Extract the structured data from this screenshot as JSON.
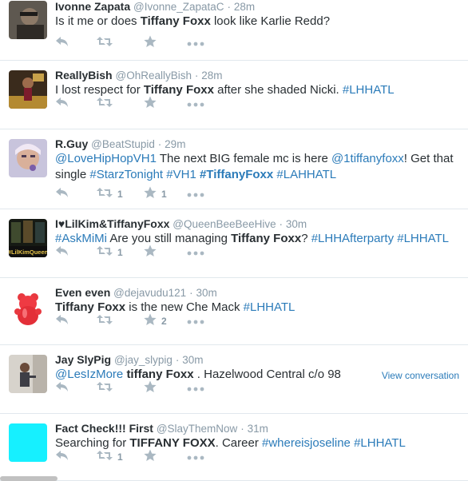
{
  "colors": {
    "link": "#2b7bb9",
    "muted": "#8899a6",
    "icon": "#aab8c2",
    "divider": "#e1e8ed"
  },
  "icons": [
    "reply-icon",
    "retweet-icon",
    "favorite-icon",
    "more-icon"
  ],
  "tweets": [
    {
      "fullname": "Ivonne Zapata",
      "username": "@Ivonne_ZapataC",
      "sep": "·",
      "time": "28m",
      "avatar": "avatar-photo-dark",
      "lines": [
        [
          {
            "t": "Is it me or does ",
            "s": "n"
          },
          {
            "t": "Tiffany Foxx",
            "s": "b"
          },
          {
            "t": " look like Karlie Redd?",
            "s": "n"
          }
        ]
      ],
      "retweets": "",
      "favorites": "",
      "view_conversation": ""
    },
    {
      "fullname": "ReallyBish",
      "username": "@OhReallyBish",
      "sep": "·",
      "time": "28m",
      "avatar": "avatar-photo-performer",
      "lines": [
        [
          {
            "t": "I lost respect for ",
            "s": "n"
          },
          {
            "t": "Tiffany Foxx",
            "s": "b"
          },
          {
            "t": " after she shaded Nicki. ",
            "s": "n"
          },
          {
            "t": "#LHHATL",
            "s": "l"
          }
        ]
      ],
      "retweets": "",
      "favorites": "",
      "view_conversation": ""
    },
    {
      "fullname": "R.Guy",
      "username": "@BeatStupid",
      "sep": "·",
      "time": "29m",
      "avatar": "avatar-photo-face",
      "lines": [
        [
          {
            "t": "@LoveHipHopVH1",
            "s": "l"
          },
          {
            "t": " The next BIG female mc is here ",
            "s": "n"
          },
          {
            "t": "@1tiffanyfoxx",
            "s": "l"
          },
          {
            "t": "! Get that",
            "s": "n"
          }
        ],
        [
          {
            "t": "single ",
            "s": "n"
          },
          {
            "t": "#StarzTonight",
            "s": "l"
          },
          {
            "t": " ",
            "s": "n"
          },
          {
            "t": "#VH1",
            "s": "l"
          },
          {
            "t": " ",
            "s": "n"
          },
          {
            "t": "#TiffanyFoxx",
            "s": "lb"
          },
          {
            "t": " ",
            "s": "n"
          },
          {
            "t": "#LAHHATL",
            "s": "l"
          }
        ]
      ],
      "retweets": "1",
      "favorites": "1",
      "view_conversation": ""
    },
    {
      "fullname": "I♥LilKim&TiffanyFoxx",
      "username": "@QueenBeeBeeHive",
      "sep": "·",
      "time": "30m",
      "avatar": "avatar-lilkimqueen",
      "avatar_text": "#LilKimQueen",
      "lines": [
        [
          {
            "t": "#AskMiMi",
            "s": "l"
          },
          {
            "t": " Are you still managing ",
            "s": "n"
          },
          {
            "t": "Tiffany Foxx",
            "s": "b"
          },
          {
            "t": "? ",
            "s": "n"
          },
          {
            "t": "#LHHAfterparty",
            "s": "l"
          },
          {
            "t": " ",
            "s": "n"
          },
          {
            "t": "#LHHATL",
            "s": "l"
          }
        ]
      ],
      "retweets": "1",
      "favorites": "",
      "view_conversation": ""
    },
    {
      "fullname": "Even even",
      "username": "@dejavudu121",
      "sep": "·",
      "time": "30m",
      "avatar": "avatar-gummy-bear",
      "lines": [
        [
          {
            "t": "Tiffany Foxx",
            "s": "b"
          },
          {
            "t": " is the new Che Mack ",
            "s": "n"
          },
          {
            "t": "#LHHATL",
            "s": "l"
          }
        ]
      ],
      "retweets": "",
      "favorites": "2",
      "view_conversation": ""
    },
    {
      "fullname": "Jay SlyPig",
      "username": "@jay_slypig",
      "sep": "·",
      "time": "30m",
      "avatar": "avatar-photo-person",
      "lines": [
        [
          {
            "t": "@LesIzMore",
            "s": "l"
          },
          {
            "t": " ",
            "s": "n"
          },
          {
            "t": "tiffany Foxx",
            "s": "b"
          },
          {
            "t": " . Hazelwood Central c/o 98",
            "s": "n"
          }
        ]
      ],
      "retweets": "",
      "favorites": "",
      "view_conversation": "View conversation"
    },
    {
      "fullname": "Fact Check!!! First",
      "username": "@SlayThemNow",
      "sep": "·",
      "time": "31m",
      "avatar": "avatar-cyan",
      "lines": [
        [
          {
            "t": "Searching for ",
            "s": "n"
          },
          {
            "t": "TIFFANY FOXX",
            "s": "b"
          },
          {
            "t": ". Career ",
            "s": "n"
          },
          {
            "t": "#whereisjoseline",
            "s": "l"
          },
          {
            "t": " ",
            "s": "n"
          },
          {
            "t": "#LHHATL",
            "s": "l"
          }
        ]
      ],
      "retweets": "1",
      "favorites": "",
      "view_conversation": ""
    }
  ]
}
